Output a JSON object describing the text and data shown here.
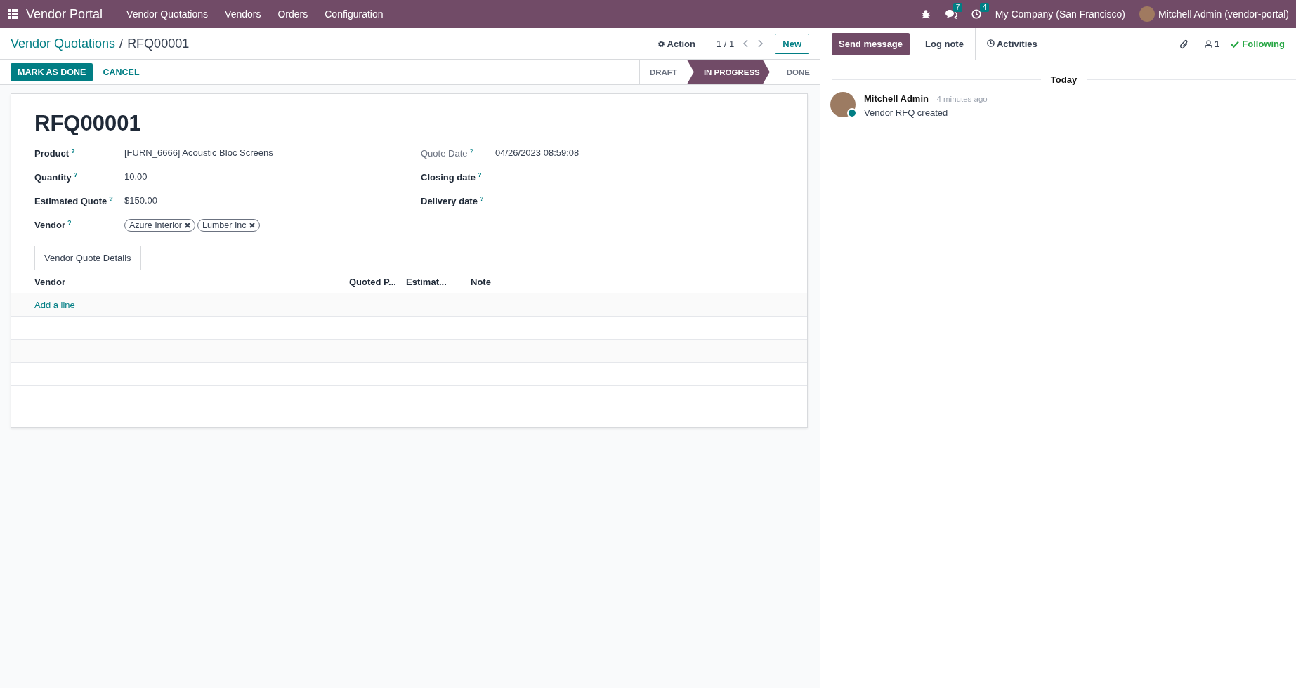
{
  "navbar": {
    "app_name": "Vendor Portal",
    "menu": [
      "Vendor Quotations",
      "Vendors",
      "Orders",
      "Configuration"
    ],
    "messages_count": "7",
    "activities_count": "4",
    "company": "My Company (San Francisco)",
    "user": "Mitchell Admin (vendor-portal)"
  },
  "control_panel": {
    "breadcrumbs": [
      "Vendor Quotations",
      "RFQ00001"
    ],
    "breadcrumb_separator": "/",
    "action": "Action",
    "pager": "1 / 1",
    "new_button": "New"
  },
  "status_bar": {
    "buttons": [
      {
        "label": "MARK AS DONE",
        "kind": "primary"
      },
      {
        "label": "CANCEL",
        "kind": "link"
      }
    ],
    "stages": [
      {
        "label": "DRAFT",
        "selected": false
      },
      {
        "label": "IN PROGRESS",
        "selected": true
      },
      {
        "label": "DONE",
        "selected": false
      }
    ]
  },
  "form": {
    "title": "RFQ00001",
    "left_fields": [
      {
        "label": "Product",
        "help": "?",
        "value": "[FURN_6666] Acoustic Bloc Screens",
        "readonly": false
      },
      {
        "label": "Quantity",
        "help": "?",
        "value": "10.00",
        "readonly": false
      },
      {
        "label": "Estimated Quote",
        "help": "?",
        "value": "$150.00",
        "readonly": false
      },
      {
        "label": "Vendor",
        "help": "?",
        "tags": [
          "Azure Interior",
          "Lumber Inc"
        ],
        "readonly": false
      }
    ],
    "right_fields": [
      {
        "label": "Quote Date",
        "help": "?",
        "value": "04/26/2023 08:59:08",
        "readonly": true
      },
      {
        "label": "Closing date",
        "help": "?",
        "readonly": false
      },
      {
        "label": "Delivery date",
        "help": "?",
        "readonly": false
      }
    ],
    "tabs": [
      {
        "label": "Vendor Quote Details",
        "selected": true
      }
    ],
    "table": {
      "columns": [
        "Vendor",
        "Quoted P...",
        "Estimat...",
        "Note"
      ],
      "add_line": "Add a line"
    }
  },
  "chatter": {
    "buttons": [
      {
        "label": "Send message",
        "selected": true
      },
      {
        "label": "Log note",
        "selected": false
      },
      {
        "label": "Activities",
        "selected": false
      }
    ],
    "followers_count": "1",
    "following": "Following",
    "date_separator": "Today",
    "messages": [
      {
        "author": "Mitchell Admin",
        "time": "- 4 minutes ago",
        "body": "Vendor RFQ created",
        "online": true
      }
    ]
  }
}
